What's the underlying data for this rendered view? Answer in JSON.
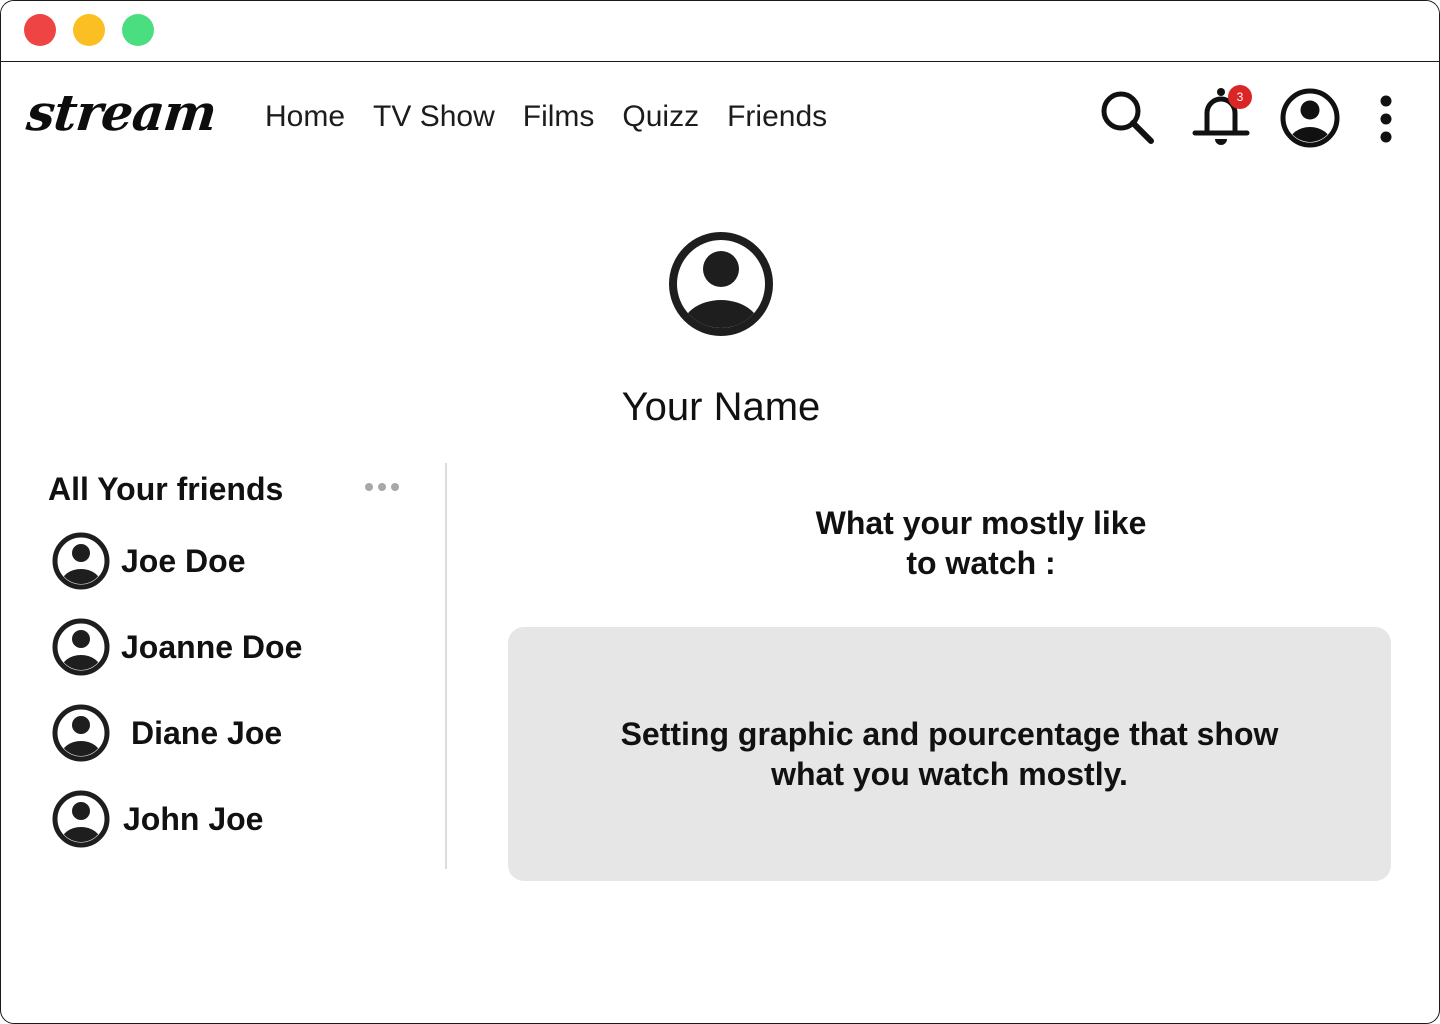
{
  "window": {
    "colors": {
      "close": "#ef4444",
      "minimize": "#fbbf24",
      "maximize": "#4ade80"
    }
  },
  "header": {
    "logo": "stream",
    "nav": [
      {
        "label": "Home"
      },
      {
        "label": "TV Show"
      },
      {
        "label": "Films"
      },
      {
        "label": "Quizz"
      },
      {
        "label": "Friends"
      }
    ],
    "icons": [
      "search-icon",
      "bell-icon",
      "account-icon",
      "more-vertical-icon"
    ],
    "notification_count": "3",
    "badge_color": "#dc2626"
  },
  "profile": {
    "name": "Your Name"
  },
  "friends": {
    "title": "All Your friends",
    "items": [
      {
        "name": "Joe Doe"
      },
      {
        "name": "Joanne Doe"
      },
      {
        "name": "Diane Joe"
      },
      {
        "name": "John Joe"
      }
    ]
  },
  "watch": {
    "heading_line1": "What your mostly like",
    "heading_line2": "to watch :",
    "card_line1": "Setting graphic and pourcentage that show",
    "card_line2": "what you watch mostly."
  }
}
